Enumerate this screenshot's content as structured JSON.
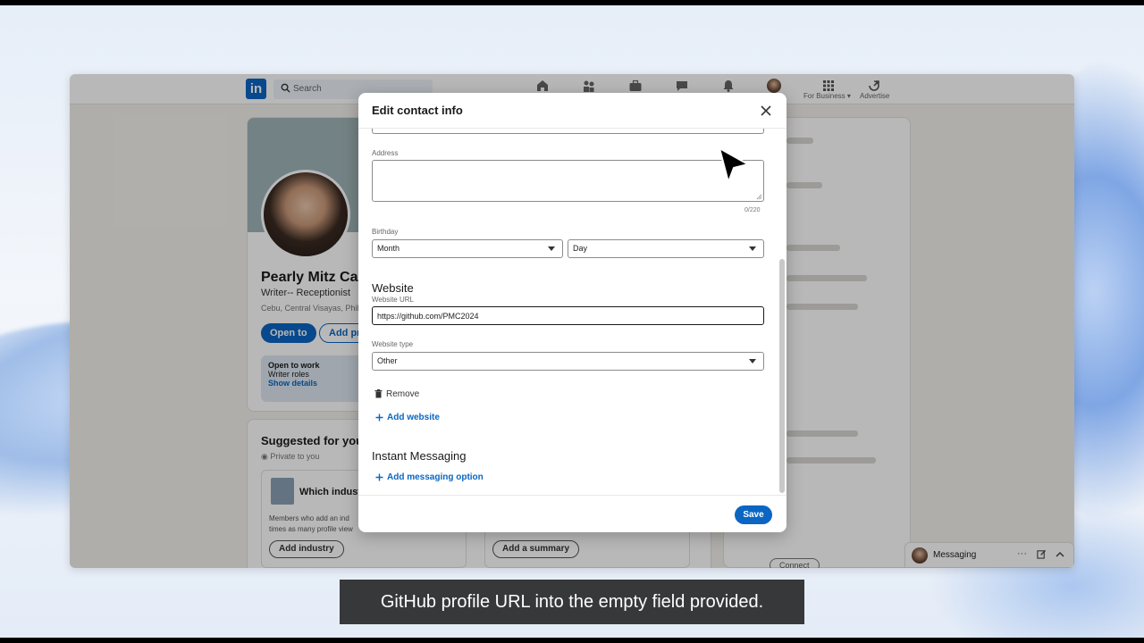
{
  "linkedin": {
    "logo_text": "in",
    "search_placeholder": "Search",
    "nav": {
      "for_business": "For Business",
      "advertise": "Advertise"
    }
  },
  "profile": {
    "name": "Pearly Mitz Cap",
    "headline": "Writer-- Receptionist",
    "location": "Cebu, Central Visayas, Philip",
    "open_to_label": "Open to",
    "add_profile_label": "Add pr",
    "open_to_work": {
      "title": "Open to work",
      "roles": "Writer roles",
      "show_details": "Show details"
    }
  },
  "suggested": {
    "title": "Suggested for you",
    "private": "Private to you",
    "industry_heading": "Which industr",
    "industry_desc_1": "Members who add an ind",
    "industry_desc_2": "times as many profile view",
    "add_industry": "Add industry",
    "add_summary": "Add a summary"
  },
  "right_rail": {
    "connect": "Connect"
  },
  "messaging": {
    "label": "Messaging",
    "more": "···"
  },
  "modal": {
    "title": "Edit contact info",
    "address_label": "Address",
    "address_value": "",
    "address_count": "0/220",
    "birthday_label": "Birthday",
    "month_value": "Month",
    "day_value": "Day",
    "website_section": "Website",
    "website_url_label": "Website URL",
    "website_url_value": "https://github.com/PMC2024",
    "website_type_label": "Website type",
    "website_type_value": "Other",
    "remove_label": "Remove",
    "add_website_label": "Add website",
    "instant_messaging_section": "Instant Messaging",
    "add_messaging_label": "Add messaging option",
    "save_label": "Save"
  },
  "caption": "GitHub profile URL into the empty field provided.",
  "colors": {
    "brand_blue": "#0a66c2",
    "caption_bg": "#282828"
  }
}
